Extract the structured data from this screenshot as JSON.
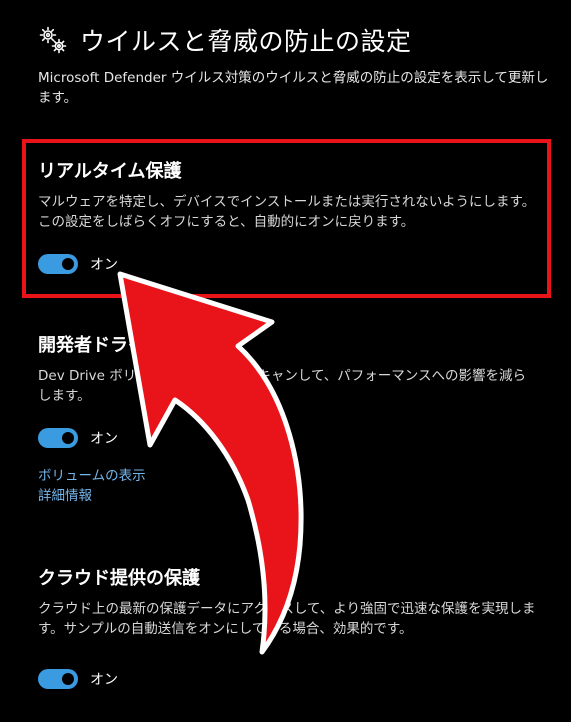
{
  "header": {
    "icon": "gears-icon",
    "title": "ウイルスと脅威の防止の設定"
  },
  "description": "Microsoft Defender ウイルス対策のウイルスと脅威の防止の設定を表示して更新します。",
  "sections": [
    {
      "title": "リアルタイム保護",
      "description": "マルウェアを特定し、デバイスでインストールまたは実行されないようにします。この設定をしばらくオフにすると、自動的にオンに戻ります。",
      "toggle": {
        "state": "on",
        "label": "オン"
      }
    },
    {
      "title": "開発者ドライブの保護",
      "description": "Dev Drive ボリュームを非同期にスキャンして、パフォーマンスへの影響を減らします。",
      "toggle": {
        "state": "on",
        "label": "オン"
      },
      "links": [
        "ボリュームの表示",
        "詳細情報"
      ]
    },
    {
      "title": "クラウド提供の保護",
      "description": "クラウド上の最新の保護データにアクセスして、より強固で迅速な保護を実現します。サンプルの自動送信をオンにしている場合、効果的です。",
      "toggle": {
        "state": "on",
        "label": "オン"
      }
    }
  ],
  "colors": {
    "background": "#000000",
    "toggle_on": "#3a9be0",
    "link": "#74b6ec",
    "annotation": "#e8141a"
  }
}
